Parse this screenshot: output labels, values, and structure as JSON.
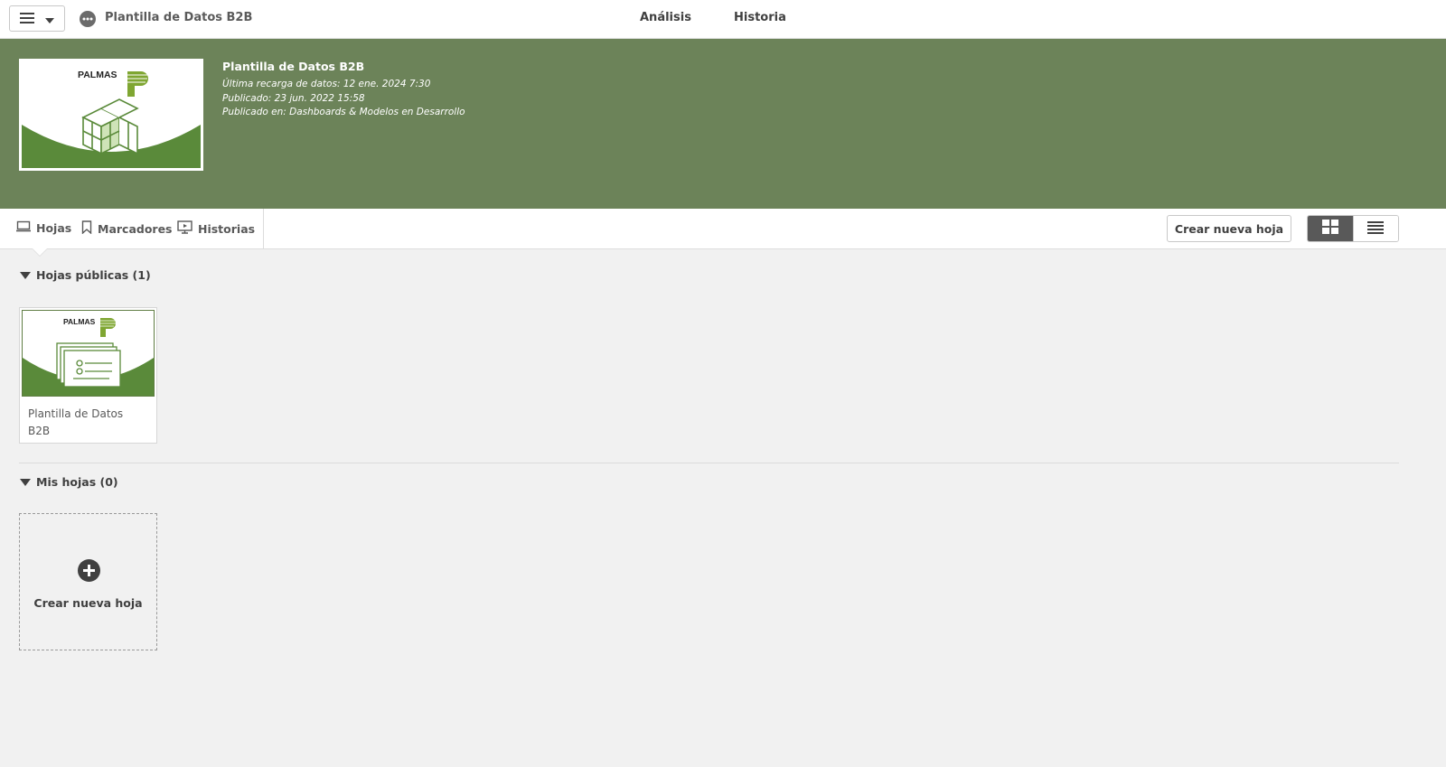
{
  "topbar": {
    "app_title": "Plantilla de Datos B2B",
    "tabs": [
      {
        "label": "Análisis"
      },
      {
        "label": "Historia"
      }
    ]
  },
  "hero": {
    "logo_text": "PALMAS",
    "title": "Plantilla de Datos B2B",
    "last_reload": "Última recarga de datos: 12 ene. 2024 7:30",
    "published": "Publicado: 23 jun. 2022 15:58",
    "published_in": "Publicado en: Dashboards & Modelos en Desarrollo",
    "brand_color": "#6c8359",
    "accent_green": "#5a8a3a"
  },
  "subbar": {
    "tabs": [
      {
        "label": "Hojas",
        "icon": "sheet-icon"
      },
      {
        "label": "Marcadores",
        "icon": "bookmark-icon"
      },
      {
        "label": "Historias",
        "icon": "story-icon"
      }
    ],
    "create_button": "Crear nueva hoja",
    "view_mode": "grid"
  },
  "public_sheets": {
    "header": "Hojas públicas (1)",
    "items": [
      {
        "title": "Plantilla de Datos B2B",
        "logo_text": "PALMAS"
      }
    ]
  },
  "my_sheets": {
    "header": "Mis hojas (0)",
    "create_label": "Crear nueva hoja"
  }
}
